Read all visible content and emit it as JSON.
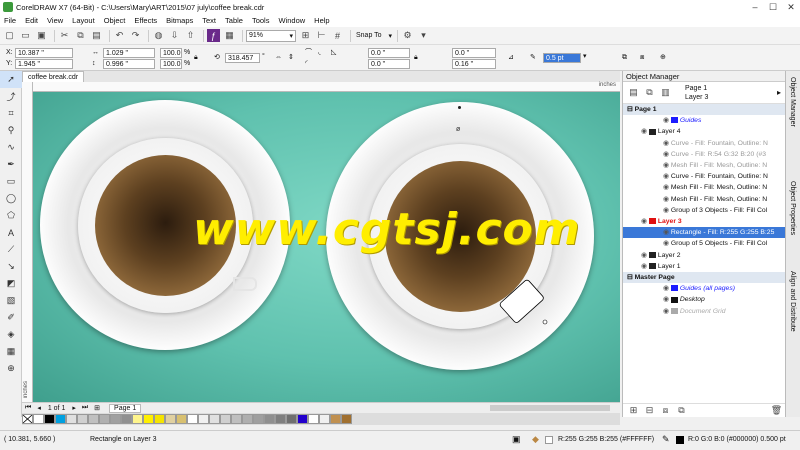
{
  "window": {
    "title": "CorelDRAW X7 (64-Bit) - C:\\Users\\Mary\\ART\\2015\\07 july\\coffee break.cdr"
  },
  "menu": [
    "File",
    "Edit",
    "View",
    "Layout",
    "Object",
    "Effects",
    "Bitmaps",
    "Text",
    "Table",
    "Tools",
    "Window",
    "Help"
  ],
  "toolbar": {
    "zoom": "91%",
    "snap_to": "Snap To"
  },
  "property_bar": {
    "x": "10.387 \"",
    "y": "1.945 \"",
    "width": "1.029 \"",
    "height": "0.996 \"",
    "scale_w": "100.0",
    "scale_h": "100.0",
    "scale_unit": "%",
    "rotation": "318.457",
    "rotation_unit": "°",
    "corner_1": "0.0 \"",
    "corner_2": "0.0 \"",
    "corner_3": "0.0 \"",
    "corner_4": "0.16 \"",
    "outline_width": "0.5 pt"
  },
  "document": {
    "tab": "coffee break.cdr",
    "ruler_unit": "inches",
    "watermark": "www.cgtsj.com"
  },
  "page_nav": {
    "page_count": "1 of 1",
    "page_tab": "Page 1"
  },
  "object_manager": {
    "title": "Object Manager",
    "current": {
      "page": "Page 1",
      "layer": "Layer 3"
    },
    "rows": [
      {
        "text": "Page 1",
        "type": "section"
      },
      {
        "text": "Guides",
        "color": "#1c1cff",
        "italic": true
      },
      {
        "text": "Layer 4",
        "color": "#222222"
      },
      {
        "text": "Curve - Fill: Fountain, Outline: N",
        "dim": true
      },
      {
        "text": "Curve - Fill: R:54 G:32 B:20 (#3",
        "dim": true
      },
      {
        "text": "Mesh Fill - Fill: Mesh, Outline: N",
        "dim": true
      },
      {
        "text": "Curve - Fill: Fountain, Outline: N"
      },
      {
        "text": "Mesh Fill - Fill: Mesh, Outline: N"
      },
      {
        "text": "Mesh Fill - Fill: Mesh, Outline: N"
      },
      {
        "text": "Group of 3 Objects - Fill: Fill Col"
      },
      {
        "text": "Layer 3",
        "color": "#e01010",
        "active": true
      },
      {
        "text": "Rectangle - Fill: R:255 G:255 B:25",
        "selected": true
      },
      {
        "text": "Group of 5 Objects - Fill: Fill Col"
      },
      {
        "text": "Layer 2",
        "color": "#222222"
      },
      {
        "text": "Layer 1",
        "color": "#222222"
      },
      {
        "text": "Master Page",
        "type": "section"
      },
      {
        "text": "Guides (all pages)",
        "color": "#1c1cff",
        "italic": true
      },
      {
        "text": "Desktop",
        "color": "#111111",
        "italic": true
      },
      {
        "text": "Document Grid",
        "color": "#aaaaaa",
        "italic": true
      }
    ]
  },
  "side_tabs": [
    "Object Manager",
    "Object Properties",
    "Align and Distribute"
  ],
  "palette": [
    "#ffffff",
    "#000000",
    "#00a0e0",
    "#e0e0e0",
    "#d0d0d0",
    "#c0c0c0",
    "#b0b0b0",
    "#a0a0a0",
    "#909090",
    "#fff58c",
    "#ffef00",
    "#f5e400",
    "#e0d0a0",
    "#d8c070",
    "#ffffff",
    "#f0f0f0",
    "#e0e0e0",
    "#cfcfcf",
    "#bfbfbf",
    "#afafaf",
    "#9f9f9f",
    "#8f8f8f",
    "#7f7f7f",
    "#6f6f6f",
    "#2200cc",
    "#ffffff",
    "#f0f0f0",
    "#c09050",
    "#a07030"
  ],
  "status": {
    "coords": "( 10.381, 5.660 )",
    "message": "Rectangle on Layer 3",
    "fill": "R:255 G:255 B:255 (#FFFFFF)",
    "outline": "R:0 G:0 B:0 (#000000)  0.500 pt"
  }
}
